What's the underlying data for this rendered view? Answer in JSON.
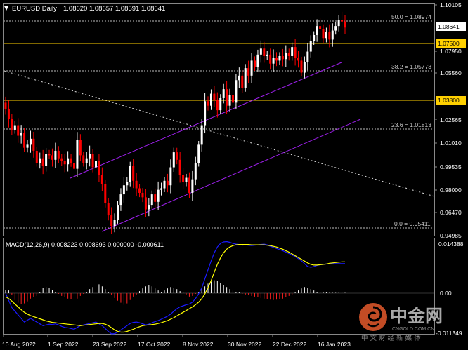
{
  "header": {
    "symbol": "EURUSD,Daily",
    "ohlc": "1.08620 1.08657 1.08591 1.08641"
  },
  "price_axis": {
    "ticks": [
      "1.10105",
      "1.07950",
      "1.05560",
      "1.04075",
      "1.02565",
      "1.01010",
      "0.99535",
      "0.98000",
      "0.96470",
      "0.94985"
    ],
    "last_price": "1.08641",
    "hline_labels": [
      "1.07500",
      "1.03800"
    ]
  },
  "fib_labels": [
    "50.0 = 1.08974",
    "38.2 = 1.05773",
    "23.6 = 1.01813",
    "0.0 = 0.95411"
  ],
  "macd": {
    "label": "MACD(12,26,9) 0.008223 0.008693 0.000000 -0.000611",
    "ticks": [
      "0.014388",
      "0.00",
      "-0.011349"
    ]
  },
  "time_axis": [
    "10 Aug 2022",
    "1 Sep 2022",
    "23 Sep 2022",
    "17 Oct 2022",
    "8 Nov 2022",
    "30 Nov 2022",
    "22 Dec 2022",
    "16 Jan 2023"
  ],
  "watermark": {
    "brand": "中金网",
    "url": "CNGOLD.COM.CN",
    "slogan": "中 文 财 经 新 媒 体"
  },
  "colors": {
    "bull": "#ffffff",
    "bear": "#ff0000",
    "hline": "#ffd000",
    "channel": "#a020f0",
    "macd_signal": "#ffff00",
    "macd_main": "#1a1aff"
  },
  "chart_data": {
    "type": "candlestick",
    "symbol": "EURUSD",
    "timeframe": "Daily",
    "ylim": [
      0.9475,
      1.102
    ],
    "horizontal_lines": [
      1.075,
      1.038
    ],
    "fibonacci_levels": [
      {
        "ratio": "50.0",
        "price": 1.08974
      },
      {
        "ratio": "38.2",
        "price": 1.05773
      },
      {
        "ratio": "23.6",
        "price": 1.01813
      },
      {
        "ratio": "0.0",
        "price": 0.95411
      }
    ],
    "closes": [
      1.032,
      1.025,
      1.018,
      1.021,
      1.014,
      1.016,
      1.006,
      1.008,
      1.012,
      1.004,
      0.996,
      0.999,
      0.994,
      1.002,
      1.001,
      0.998,
      1.004,
      0.999,
      0.997,
      0.995,
      0.999,
      0.996,
      0.992,
      1.011,
      1.001,
      0.996,
      0.999,
      1.002,
      0.993,
      0.997,
      0.988,
      0.982,
      0.969,
      0.961,
      0.954,
      0.958,
      0.968,
      0.975,
      0.981,
      0.983,
      0.994,
      0.984,
      0.979,
      0.976,
      0.973,
      0.965,
      0.968,
      0.975,
      0.97,
      0.978,
      0.979,
      0.984,
      0.981,
      0.993,
      1.003,
      0.998,
      0.988,
      0.983,
      0.986,
      0.976,
      0.985,
      0.996,
      1.008,
      1.021,
      1.037,
      1.034,
      1.042,
      1.038,
      1.031,
      1.039,
      1.045,
      1.034,
      1.041,
      1.036,
      1.051,
      1.054,
      1.046,
      1.059,
      1.054,
      1.064,
      1.06,
      1.068,
      1.072,
      1.067,
      1.068,
      1.062,
      1.066,
      1.064,
      1.067,
      1.065,
      1.069,
      1.067,
      1.073,
      1.066,
      1.064,
      1.056,
      1.063,
      1.07,
      1.077,
      1.081,
      1.087,
      1.085,
      1.079,
      1.083,
      1.078,
      1.084,
      1.087,
      1.091,
      1.09,
      1.086
    ],
    "macd_main": [
      0.0,
      -0.002,
      -0.004,
      -0.005,
      -0.006,
      -0.007,
      -0.008,
      -0.0075,
      -0.007,
      -0.0075,
      -0.008,
      -0.0085,
      -0.009,
      -0.0088,
      -0.0086,
      -0.0087,
      -0.0085,
      -0.0088,
      -0.0092,
      -0.0095,
      -0.0096,
      -0.0098,
      -0.01,
      -0.0095,
      -0.009,
      -0.0088,
      -0.0086,
      -0.0084,
      -0.0082,
      -0.008,
      -0.0085,
      -0.009,
      -0.0098,
      -0.0106,
      -0.0113,
      -0.0112,
      -0.0108,
      -0.0102,
      -0.0096,
      -0.009,
      -0.0084,
      -0.0081,
      -0.008,
      -0.0082,
      -0.0085,
      -0.0088,
      -0.0086,
      -0.0082,
      -0.0079,
      -0.0076,
      -0.0072,
      -0.0068,
      -0.0064,
      -0.0058,
      -0.005,
      -0.0043,
      -0.0038,
      -0.0035,
      -0.0032,
      -0.003,
      -0.0025,
      -0.0015,
      -0.0002,
      0.0015,
      0.004,
      0.0065,
      0.009,
      0.0112,
      0.0128,
      0.0138,
      0.0142,
      0.0143,
      0.0141,
      0.0138,
      0.0136,
      0.0135,
      0.0133,
      0.0134,
      0.0133,
      0.0132,
      0.0133,
      0.0134,
      0.0135,
      0.0136,
      0.0134,
      0.013,
      0.0127,
      0.0124,
      0.0121,
      0.0118,
      0.0114,
      0.011,
      0.0106,
      0.0101,
      0.0096,
      0.009,
      0.0082,
      0.0074,
      0.0072,
      0.0074,
      0.0077,
      0.0079,
      0.008,
      0.0081,
      0.0082,
      0.0082,
      0.0082,
      0.0082,
      0.0082,
      0.0082
    ],
    "macd_signal": [
      -0.001,
      -0.0015,
      -0.0022,
      -0.003,
      -0.0038,
      -0.0046,
      -0.0053,
      -0.0058,
      -0.0062,
      -0.0065,
      -0.0068,
      -0.0071,
      -0.0074,
      -0.0077,
      -0.0079,
      -0.0081,
      -0.0082,
      -0.0083,
      -0.0084,
      -0.0085,
      -0.0086,
      -0.0087,
      -0.0088,
      -0.0089,
      -0.009,
      -0.0089,
      -0.0088,
      -0.0087,
      -0.0086,
      -0.0085,
      -0.0084,
      -0.0084,
      -0.0086,
      -0.009,
      -0.0096,
      -0.0102,
      -0.0106,
      -0.0108,
      -0.0108,
      -0.0106,
      -0.0103,
      -0.01,
      -0.0096,
      -0.0093,
      -0.009,
      -0.0089,
      -0.0088,
      -0.0087,
      -0.0086,
      -0.0084,
      -0.0082,
      -0.0079,
      -0.0076,
      -0.0072,
      -0.0068,
      -0.0063,
      -0.0058,
      -0.0053,
      -0.0048,
      -0.0043,
      -0.0038,
      -0.0032,
      -0.0025,
      -0.0015,
      -0.0002,
      0.0015,
      0.0035,
      0.0058,
      0.008,
      0.0098,
      0.0112,
      0.0122,
      0.0128,
      0.0132,
      0.0134,
      0.0135,
      0.0135,
      0.0135,
      0.0135,
      0.0134,
      0.0134,
      0.0134,
      0.0134,
      0.0134,
      0.0133,
      0.0132,
      0.013,
      0.0128,
      0.0125,
      0.0122,
      0.0118,
      0.0114,
      0.0109,
      0.0104,
      0.0099,
      0.0094,
      0.0089,
      0.0084,
      0.008,
      0.0078,
      0.0078,
      0.0079,
      0.008,
      0.0081,
      0.0083,
      0.0084,
      0.0085,
      0.0086,
      0.0087,
      0.0087
    ],
    "macd_histogram": [
      0.001,
      0.0008,
      -0.0004,
      -0.002,
      -0.0028,
      -0.0032,
      -0.003,
      -0.0024,
      -0.0016,
      -0.0012,
      -0.0008,
      0.0004,
      0.0016,
      0.0018,
      0.0016,
      0.001,
      0.0004,
      -0.0002,
      -0.0008,
      -0.0012,
      -0.0016,
      -0.0018,
      -0.0022,
      -0.0016,
      -0.0008,
      -0.0002,
      0.0004,
      0.0012,
      0.0018,
      0.0022,
      0.0026,
      0.002,
      0.0012,
      0.0004,
      -0.0004,
      -0.0014,
      -0.0022,
      -0.0028,
      -0.0034,
      -0.003,
      -0.002,
      -0.001,
      -0.0004,
      0.0006,
      0.0014,
      0.002,
      0.0024,
      0.002,
      0.0014,
      0.0008,
      0.0002,
      0.0008,
      0.0014,
      0.0018,
      0.0016,
      0.0012,
      0.0006,
      0.0002,
      -0.0004,
      -0.001,
      -0.0008,
      -0.0002,
      0.0004,
      0.0012,
      0.002,
      0.0028,
      0.0034,
      0.0038,
      0.0036,
      0.003,
      0.0024,
      0.0018,
      0.0012,
      0.0008,
      0.0004,
      0.0002,
      -0.0002,
      -0.0004,
      -0.0006,
      -0.0008,
      -0.001,
      -0.0012,
      -0.0014,
      -0.0016,
      -0.0018,
      -0.0019,
      -0.002,
      -0.0019,
      -0.0018,
      -0.0016,
      -0.0012,
      -0.0008,
      -0.0004,
      0.0002,
      0.0008,
      0.0014,
      0.0018,
      0.0016,
      0.0012,
      0.0008,
      0.0004,
      0.0003,
      0.0002,
      0.0002,
      0.0001,
      0.0001,
      0.0001,
      0.0001,
      0.0001,
      0.0001
    ]
  }
}
